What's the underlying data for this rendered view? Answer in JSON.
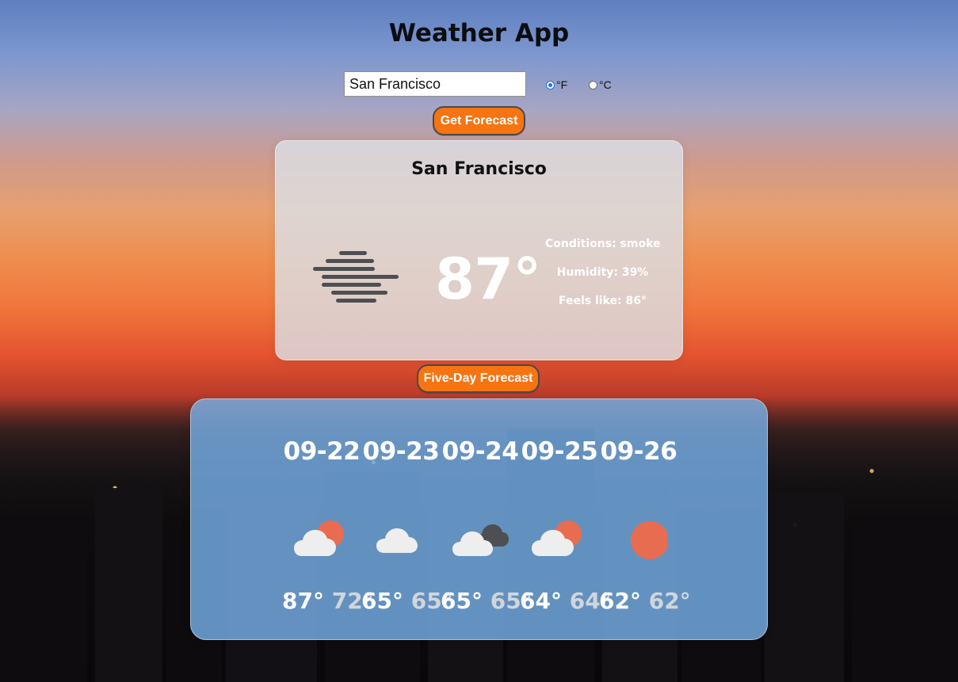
{
  "app": {
    "title": "Weather App"
  },
  "search": {
    "value": "San Francisco",
    "placeholder": "",
    "units": [
      {
        "label": "°F",
        "selected": true
      },
      {
        "label": "°C",
        "selected": false
      }
    ],
    "button_label": "Get Forecast"
  },
  "current": {
    "city": "San Francisco",
    "icon": "smoke-icon",
    "temperature": "87°",
    "conditions": "Conditions: smoke",
    "humidity": "Humidity: 39%",
    "feels_like": "Feels like: 86°"
  },
  "forecast": {
    "button_label": "Five-Day Forecast",
    "days": [
      {
        "date": "09-22",
        "icon": "partly-sunny-icon",
        "high": "87°",
        "low": "72°"
      },
      {
        "date": "09-23",
        "icon": "cloudy-icon",
        "high": "65°",
        "low": "65°"
      },
      {
        "date": "09-24",
        "icon": "overcast-icon",
        "high": "65°",
        "low": "65°"
      },
      {
        "date": "09-25",
        "icon": "partly-sunny-icon",
        "high": "64°",
        "low": "64°"
      },
      {
        "date": "09-26",
        "icon": "sunny-icon",
        "high": "62°",
        "low": "62°"
      }
    ]
  },
  "colors": {
    "button": "#f67411",
    "panel_blue": "#76afe6",
    "sun": "#e86c50"
  }
}
